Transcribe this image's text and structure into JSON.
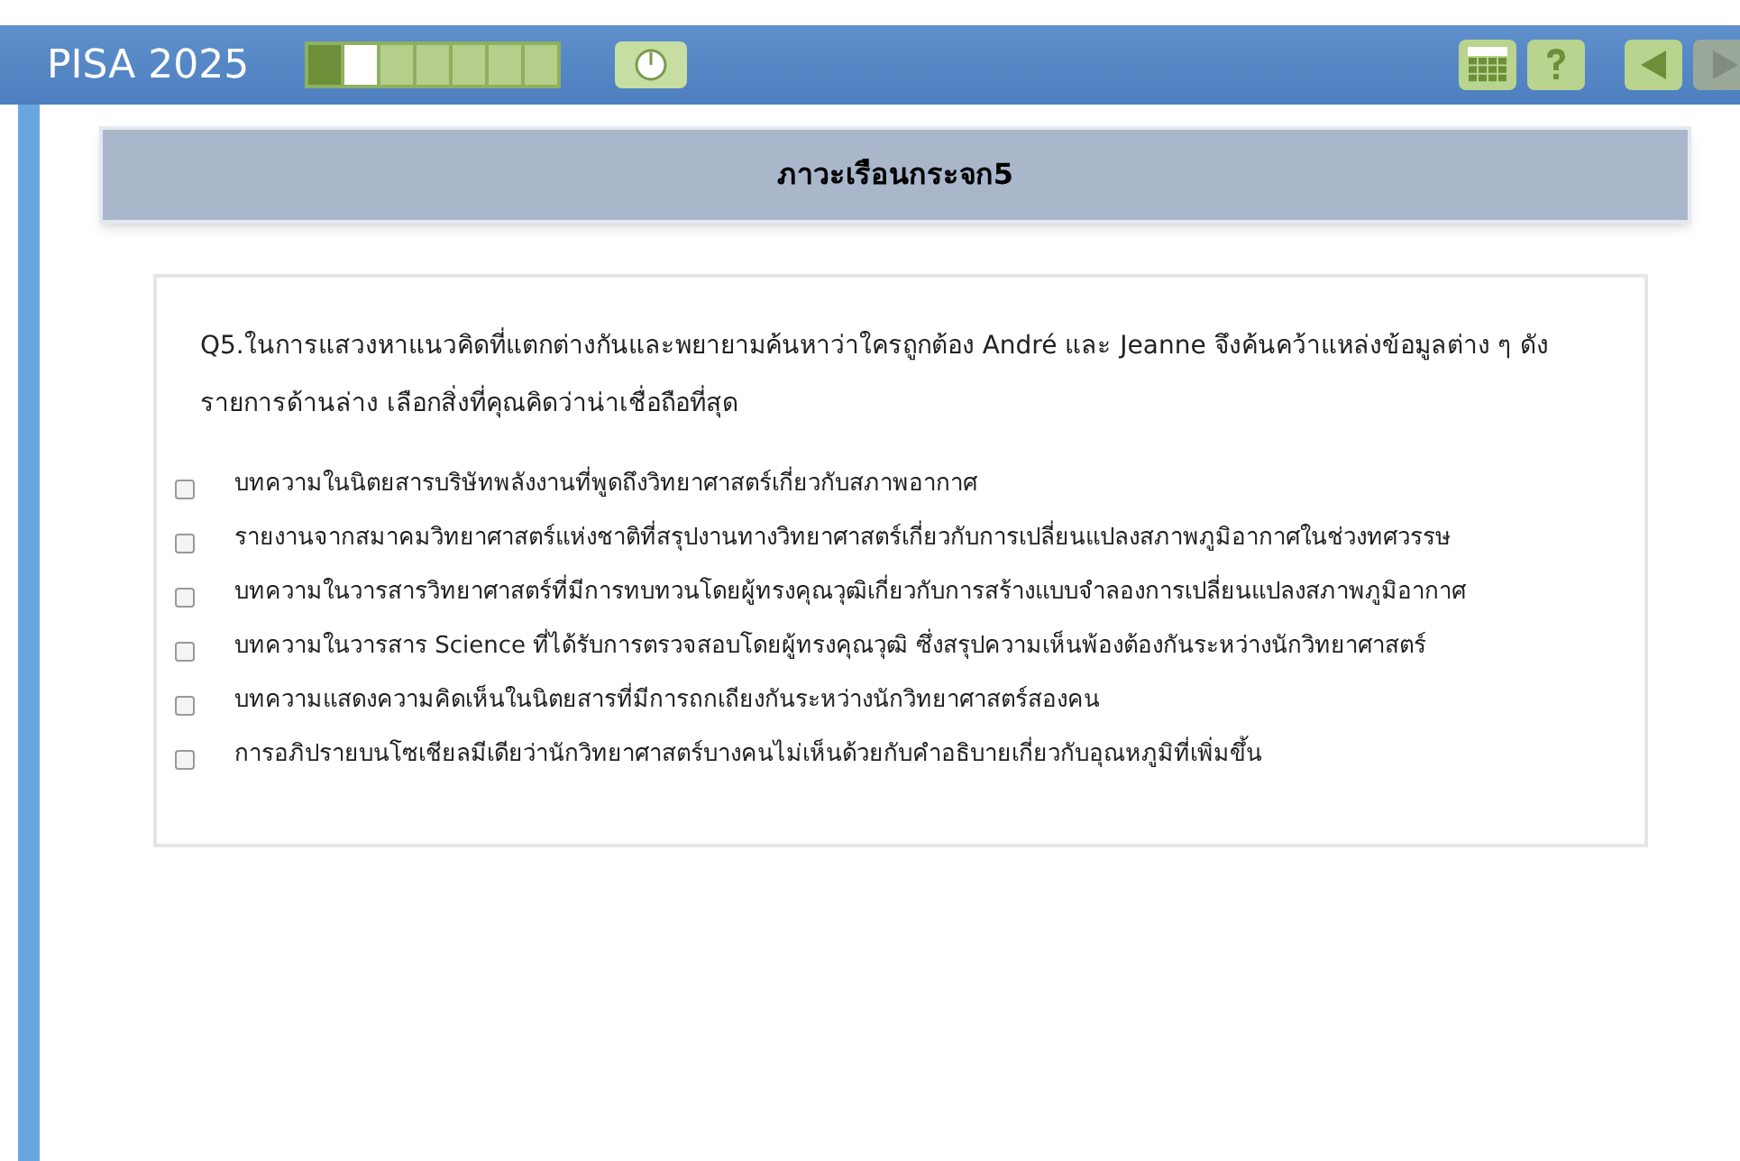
{
  "header": {
    "title": "PISA 2025",
    "progress": [
      {
        "done": true,
        "selected": false
      },
      {
        "done": false,
        "selected": true
      },
      {
        "done": false,
        "selected": false
      },
      {
        "done": false,
        "selected": false
      },
      {
        "done": false,
        "selected": false
      },
      {
        "done": false,
        "selected": false
      },
      {
        "done": false,
        "selected": false
      }
    ],
    "back_disabled": false,
    "next_disabled": true
  },
  "unit_title": "ภาวะเรือนกระจก5",
  "question": "Q5.ในการแสวงหาแนวคิดที่แตกต่างกันและพยายามค้นหาว่าใครถูกต้อง André และ Jeanne จึงค้นคว้าแหล่งข้อมูลต่าง ๆ ดังรายการด้านล่าง เลือกสิ่งที่คุณคิดว่าน่าเชื่อถือที่สุด",
  "options": [
    {
      "label": "บทความในนิตยสารบริษัทพลังงานที่พูดถึงวิทยาศาสตร์เกี่ยวกับสภาพอากาศ",
      "checked": false
    },
    {
      "label": "รายงานจากสมาคมวิทยาศาสตร์แห่งชาติที่สรุปงานทางวิทยาศาสตร์เกี่ยวกับการเปลี่ยนแปลงสภาพภูมิอากาศในช่วงทศวรรษ",
      "checked": false
    },
    {
      "label": "บทความในวารสารวิทยาศาสตร์ที่มีการทบทวนโดยผู้ทรงคุณวุฒิเกี่ยวกับการสร้างแบบจำลองการเปลี่ยนแปลงสภาพภูมิอากาศ",
      "checked": false
    },
    {
      "label": "บทความในวารสาร Science ที่ได้รับการตรวจสอบโดยผู้ทรงคุณวุฒิ ซึ่งสรุปความเห็นพ้องต้องกันระหว่างนักวิทยาศาสตร์",
      "checked": false
    },
    {
      "label": "บทความแสดงความคิดเห็นในนิตยสารที่มีการถกเถียงกันระหว่างนักวิทยาศาสตร์สองคน",
      "checked": false
    },
    {
      "label": "การอภิปรายบนโซเชียลมีเดียว่านักวิทยาศาสตร์บางคนไม่เห็นด้วยกับคำอธิบายเกี่ยวกับอุณหภูมิที่เพิ่มขึ้น",
      "checked": false
    }
  ]
}
